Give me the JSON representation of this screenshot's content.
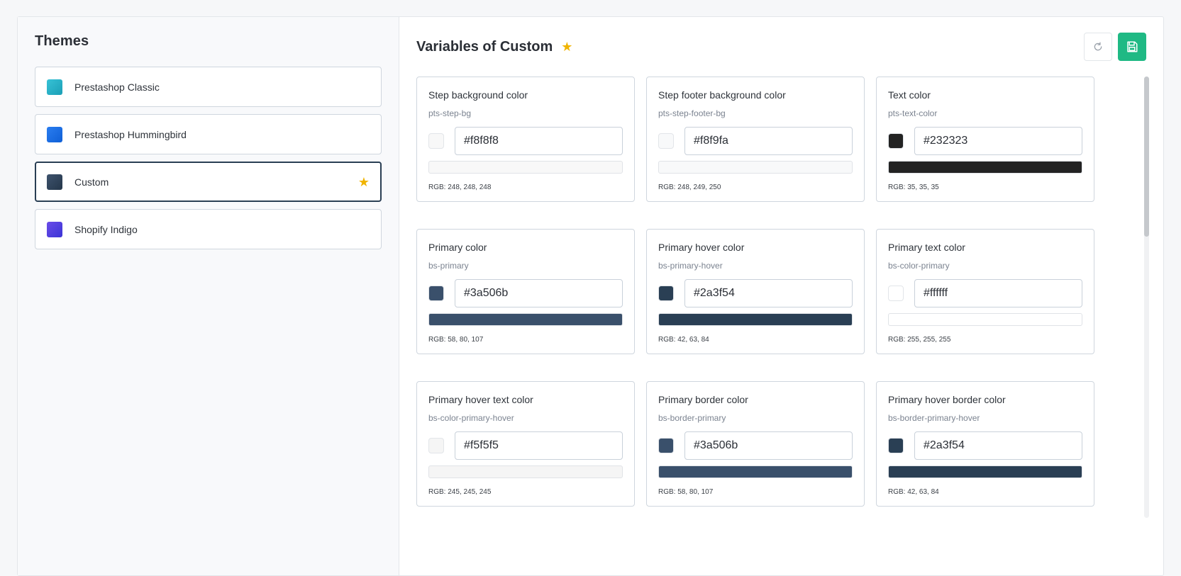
{
  "sidebar": {
    "title": "Themes",
    "themes": [
      {
        "label": "Prestashop Classic",
        "color": "#2bb3c9",
        "active": false
      },
      {
        "label": "Prestashop Hummingbird",
        "color": "#1b6fe8",
        "active": false
      },
      {
        "label": "Custom",
        "color": "#2f4259",
        "active": true,
        "starred": true
      },
      {
        "label": "Shopify Indigo",
        "color": "#5140e0",
        "active": false
      }
    ]
  },
  "main": {
    "title": "Variables of Custom",
    "reset_icon": "refresh-icon",
    "save_icon": "save-icon",
    "save_color": "#1fb984"
  },
  "variables": [
    {
      "label": "Step background color",
      "var": "pts-step-bg",
      "hex": "#f8f8f8",
      "rgb": "RGB: 248, 248, 248"
    },
    {
      "label": "Step footer background color",
      "var": "pts-step-footer-bg",
      "hex": "#f8f9fa",
      "rgb": "RGB: 248, 249, 250"
    },
    {
      "label": "Text color",
      "var": "pts-text-color",
      "hex": "#232323",
      "rgb": "RGB: 35, 35, 35"
    },
    {
      "label": "Primary color",
      "var": "bs-primary",
      "hex": "#3a506b",
      "rgb": "RGB: 58, 80, 107"
    },
    {
      "label": "Primary hover color",
      "var": "bs-primary-hover",
      "hex": "#2a3f54",
      "rgb": "RGB: 42, 63, 84"
    },
    {
      "label": "Primary text color",
      "var": "bs-color-primary",
      "hex": "#ffffff",
      "rgb": "RGB: 255, 255, 255"
    },
    {
      "label": "Primary hover text color",
      "var": "bs-color-primary-hover",
      "hex": "#f5f5f5",
      "rgb": "RGB: 245, 245, 245"
    },
    {
      "label": "Primary border color",
      "var": "bs-border-primary",
      "hex": "#3a506b",
      "rgb": "RGB: 58, 80, 107"
    },
    {
      "label": "Primary hover border color",
      "var": "bs-border-primary-hover",
      "hex": "#2a3f54",
      "rgb": "RGB: 42, 63, 84"
    }
  ]
}
